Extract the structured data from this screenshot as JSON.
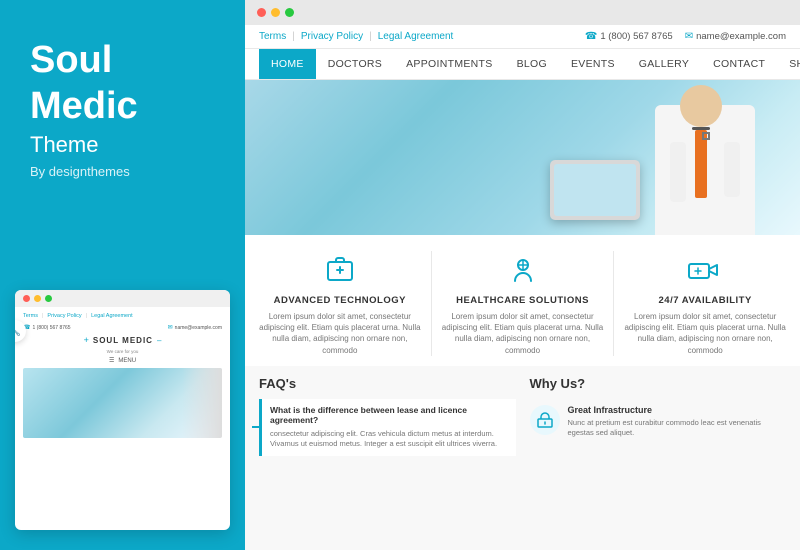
{
  "left": {
    "title_line1": "Soul",
    "title_line2": "Medic",
    "subtitle": "Theme",
    "by": "By designthemes"
  },
  "browser": {
    "topbar": {
      "links": [
        "Terms",
        "Privacy Policy",
        "Legal Agreement"
      ],
      "phone": "1 (800) 567 8765",
      "email": "name@example.com"
    },
    "nav": {
      "items": [
        "HOME",
        "DOCTORS",
        "APPOINTMENTS",
        "BLOG",
        "EVENTS",
        "GALLERY",
        "CONTACT",
        "SHOP"
      ]
    },
    "features": [
      {
        "icon": "🏥",
        "title": "ADVANCED TECHNOLOGY",
        "desc": "Lorem ipsum dolor sit amet, consectetur adipiscing elit. Etiam quis placerat urna. Nulla nulla diam, adipiscing non ornare non, commodo"
      },
      {
        "icon": "👨‍⚕️",
        "title": "HEALTHCARE SOLUTIONS",
        "desc": "Lorem ipsum dolor sit amet, consectetur adipiscing elit. Etiam quis placerat urna. Nulla nulla diam, adipiscing non ornare non, commodo"
      },
      {
        "icon": "🚑",
        "title": "24/7 AVAILABILITY",
        "desc": "Lorem ipsum dolor sit amet, consectetur adipiscing elit. Etiam quis placerat urna. Nulla nulla diam, adipiscing non ornare non, commodo"
      }
    ],
    "faqs": {
      "title": "FAQ's",
      "items": [
        {
          "question": "What is the difference between lease and licence agreement?",
          "answer": "consectetur adipiscing elit. Cras vehicula dictum metus at interdum. Vivamus ut euismod metus. Integer a est suscipit elit ultrices viverra."
        }
      ]
    },
    "why": {
      "title": "Why Us?",
      "items": [
        {
          "icon": "🏗️",
          "title": "Great Infrastructure",
          "desc": "Nunc at pretium est curabitur commodo leac est venenatis egestas sed aliquet."
        }
      ]
    }
  },
  "mini_browser": {
    "nav_links": [
      "Terms",
      "Privacy Policy",
      "Legal Agreement"
    ],
    "phone": "1 (800) 567 8765",
    "email": "name@example.com",
    "logo": "SOUL MEDIC",
    "tagline": "We care for you",
    "menu": "MENU"
  }
}
